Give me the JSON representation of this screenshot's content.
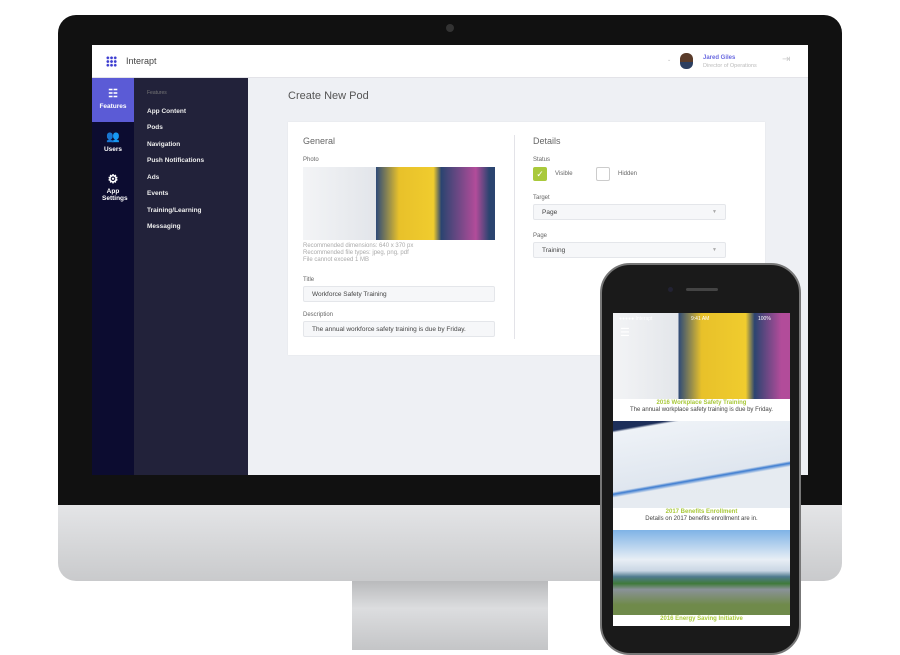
{
  "header": {
    "app_name": "Interapt",
    "user_name": "Jared Giles",
    "user_role": "Director of Operations"
  },
  "rail": [
    {
      "label": "Features",
      "icon": "features-icon"
    },
    {
      "label": "Users",
      "icon": "users-icon"
    },
    {
      "label": "App Settings",
      "icon": "gear-icon"
    }
  ],
  "subnav": {
    "heading": "Features",
    "items": [
      "App Content",
      "Pods",
      "Navigation",
      "Push Notifications",
      "Ads",
      "Events",
      "Training/Learning",
      "Messaging"
    ]
  },
  "page": {
    "title": "Create New Pod"
  },
  "general": {
    "heading": "General",
    "photo_label": "Photo",
    "hint1": "Recommended dimensions: 640 x 370 px",
    "hint2": "Recommended file types: jpeg, png, pdf",
    "hint3": "File cannot exceed 1 MB",
    "title_label": "Title",
    "title_value": "Workforce Safety Training",
    "desc_label": "Description",
    "desc_value": "The annual workforce safety training is due by Friday."
  },
  "details": {
    "heading": "Details",
    "status_label": "Status",
    "visible": "Visible",
    "hidden": "Hidden",
    "visible_checked": true,
    "target_label": "Target",
    "target_value": "Page",
    "page_label": "Page",
    "page_value": "Training"
  },
  "phone": {
    "carrier": "●●●●● Interapt",
    "time": "9:41 AM",
    "battery": "100%",
    "cards": [
      {
        "title": "2016 Workplace Safety Training",
        "desc": "The annual workplace safety training is due by Friday."
      },
      {
        "title": "2017 Benefits Enrollment",
        "desc": "Details on  2017 benefits enrollment are in."
      },
      {
        "title": "2016 Energy Saving Initiative",
        "desc": ""
      }
    ]
  },
  "colors": {
    "accent": "#5b5bd6",
    "green": "#a9c93b",
    "rail": "#0c0c30",
    "subnav": "#22223a"
  }
}
